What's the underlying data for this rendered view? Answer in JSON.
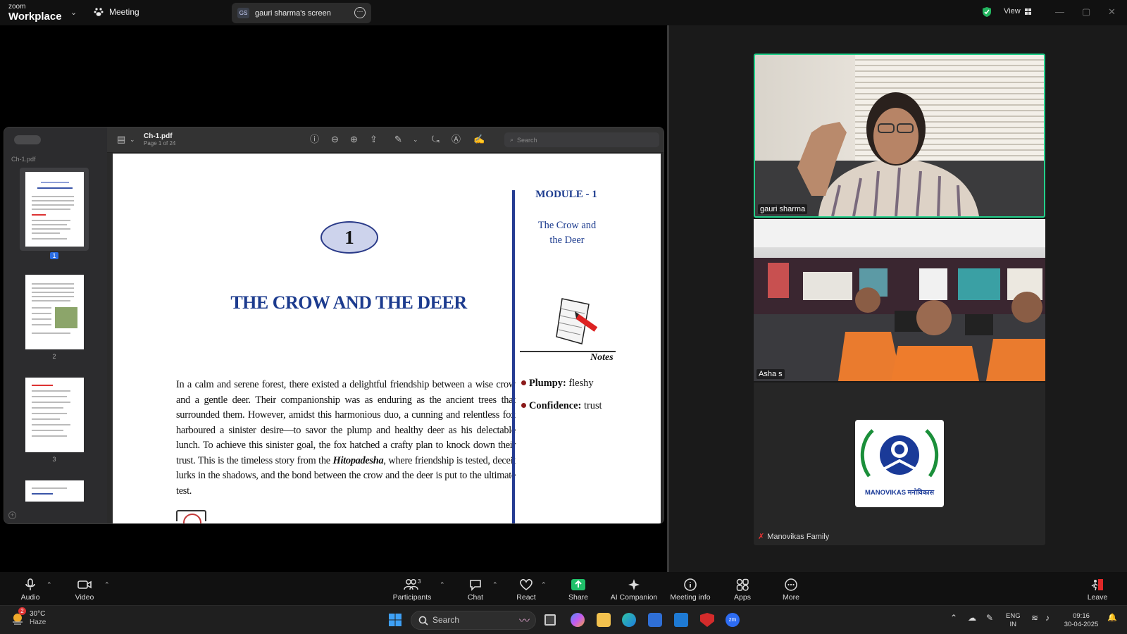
{
  "titlebar": {
    "logo_top": "zoom",
    "logo_main": "Workplace",
    "meeting_label": "Meeting",
    "screen_initials": "GS",
    "screen_label": "gauri sharma's screen",
    "view_label": "View"
  },
  "pdf": {
    "sidebar_file": "Ch-1.pdf",
    "file_name": "Ch-1.pdf",
    "page_info": "Page 1 of 24",
    "search_placeholder": "Search",
    "thumbnails": [
      {
        "label": "1",
        "selected": true
      },
      {
        "label": "2",
        "selected": false
      },
      {
        "label": "3",
        "selected": false
      }
    ],
    "page": {
      "chapter_number": "1",
      "chapter_title": "THE CROW AND THE DEER",
      "body_part1": "In a calm and serene forest, there existed a delightful friendship between a wise crow and a gentle deer. Their companionship was as enduring as the ancient trees that surrounded them. However, amidst this harmonious duo, a cunning and relentless fox harboured a sinister desire—to savor the plump and healthy deer as his delectable lunch. To achieve this sinister goal, the fox hatched a crafty plan to knock down their trust. This is the timeless story from the ",
      "body_italic": "Hitopadesha",
      "body_part2": ", where friendship is tested, deceit lurks in the shadows, and the bond between the crow and the deer is put to the ultimate test.",
      "module": "MODULE - 1",
      "module_title_line1": "The Crow and",
      "module_title_line2": "the Deer",
      "notes_label": "Notes",
      "glossary": [
        {
          "term": "Plumpy:",
          "meaning": "fleshy"
        },
        {
          "term": "Confidence:",
          "meaning": "trust"
        }
      ]
    }
  },
  "participants_tiles": [
    {
      "name": "gauri sharma",
      "active_speaker": true
    },
    {
      "name": "Asha s",
      "active_speaker": false
    },
    {
      "name": "Manovikas Family",
      "muted": true,
      "logo_text": "MANOVIKAS मनोविकास"
    }
  ],
  "controls": {
    "audio": "Audio",
    "video": "Video",
    "participants": "Participants",
    "participants_count": "3",
    "chat": "Chat",
    "react": "React",
    "share": "Share",
    "ai_companion": "AI Companion",
    "meeting_info": "Meeting info",
    "apps": "Apps",
    "more": "More",
    "leave": "Leave"
  },
  "taskbar": {
    "weather_temp": "30°C",
    "weather_desc": "Haze",
    "weather_badge": "2",
    "search_label": "Search",
    "lang_line1": "ENG",
    "lang_line2": "IN",
    "time": "09:16",
    "date": "30-04-2025"
  },
  "colors": {
    "active_speaker_border": "#23d18b",
    "share_green": "#20c06a",
    "chapter_blue": "#1c3b8e",
    "leave_red": "#e02828"
  }
}
